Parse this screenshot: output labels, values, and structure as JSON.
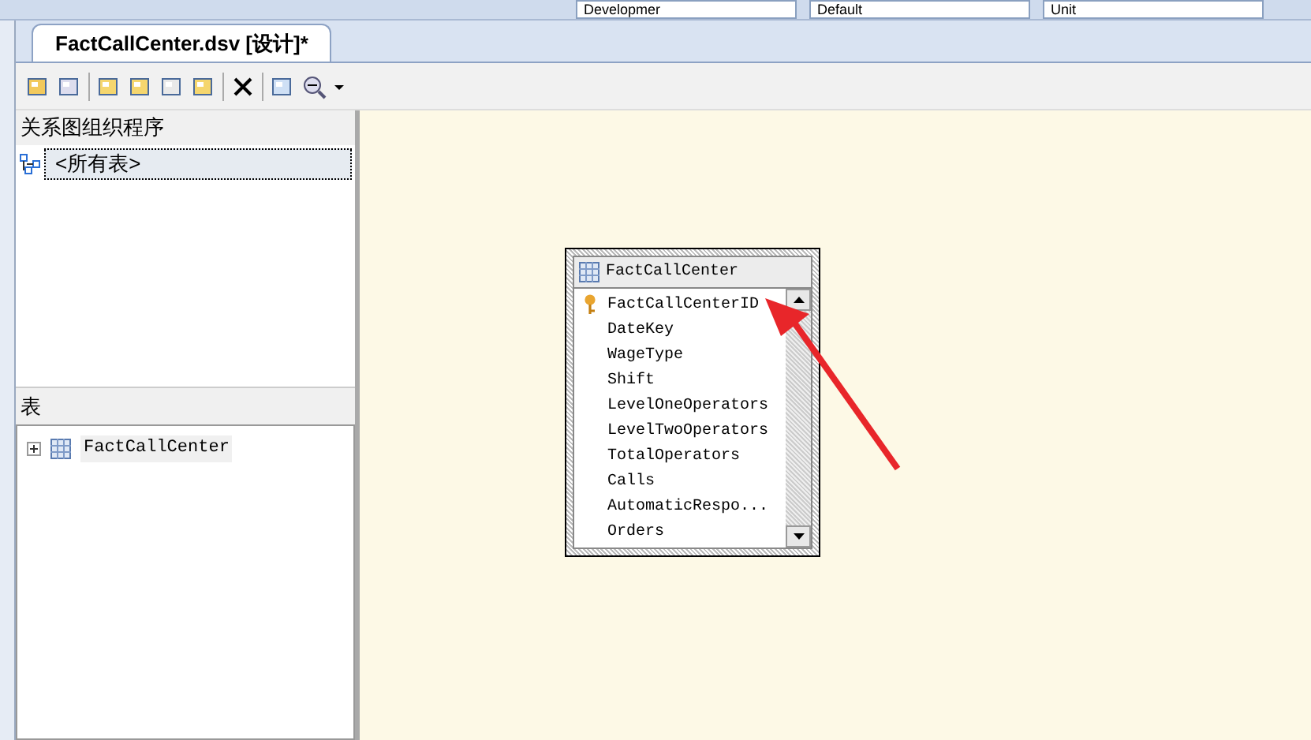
{
  "top_toolbar": {
    "combos": [
      {
        "value": "Developmer"
      },
      {
        "value": "Default"
      },
      {
        "value": "Unit"
      }
    ]
  },
  "tabs": [
    {
      "label": "FactCallCenter.dsv [设计]*",
      "selected": true
    }
  ],
  "organizer": {
    "title": "关系图组织程序",
    "items": [
      {
        "label": "<所有表>",
        "selected": true
      }
    ]
  },
  "tables_panel": {
    "title": "表",
    "items": [
      {
        "label": "FactCallCenter",
        "expanded": false
      }
    ]
  },
  "diagram": {
    "table": {
      "title": "FactCallCenter",
      "columns": [
        {
          "name": "FactCallCenterID",
          "key": true
        },
        {
          "name": "DateKey",
          "key": false
        },
        {
          "name": "WageType",
          "key": false
        },
        {
          "name": "Shift",
          "key": false
        },
        {
          "name": "LevelOneOperators",
          "key": false
        },
        {
          "name": "LevelTwoOperators",
          "key": false
        },
        {
          "name": "TotalOperators",
          "key": false
        },
        {
          "name": "Calls",
          "key": false
        },
        {
          "name": "AutomaticRespo...",
          "key": false
        },
        {
          "name": "Orders",
          "key": false
        }
      ]
    }
  }
}
